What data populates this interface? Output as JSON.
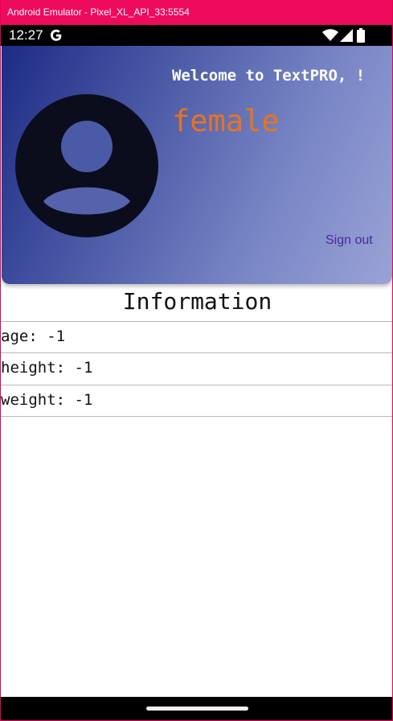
{
  "window": {
    "title": "Android Emulator - Pixel_XL_API_33:5554"
  },
  "status_bar": {
    "time": "12:27",
    "icons": [
      "google-g-icon",
      "wifi-icon",
      "signal-icon",
      "battery-icon"
    ]
  },
  "header": {
    "welcome_text": "Welcome to TextPRO, !",
    "gender": "female",
    "sign_out_label": "Sign out",
    "gender_color": "#e8731f",
    "sign_out_color": "#4a2a9a",
    "gradient_start": "#1e2b86",
    "gradient_end": "#9aa3d6"
  },
  "information": {
    "title": "Information",
    "rows": [
      {
        "text": "age: -1"
      },
      {
        "text": "height: -1"
      },
      {
        "text": "weight: -1"
      }
    ]
  },
  "colors": {
    "titlebar": "#ee0a5c",
    "avatar": "#0b0d1c"
  }
}
